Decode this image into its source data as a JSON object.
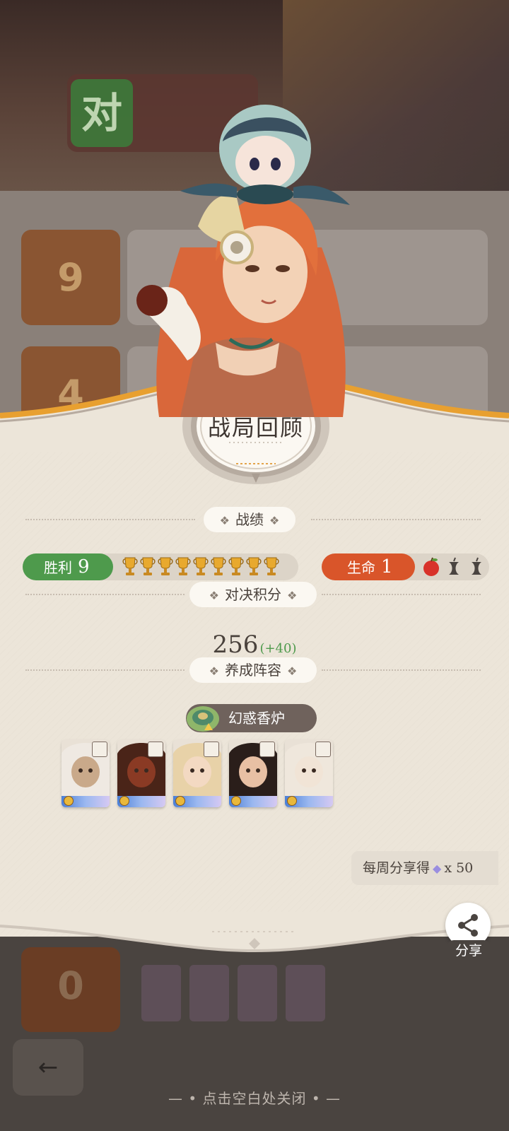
{
  "background": {
    "banner_char": "对",
    "card_values": [
      "9",
      "4"
    ],
    "bottom_card_value": "0"
  },
  "panel": {
    "title": "战局回顾",
    "record_header": "战绩",
    "wins_label": "胜利",
    "wins_value": "9",
    "trophy_count": 9,
    "life_label": "生命",
    "life_value": "1",
    "lives_remaining": 1,
    "lives_total": 3,
    "score_header": "对决积分",
    "score_value": "256",
    "score_delta": "(+40)",
    "lineup_header": "养成阵容",
    "relic_name": "幻惑香炉",
    "heroes": [
      {
        "skin": "#c9a98a",
        "hair": "#efe9e2"
      },
      {
        "skin": "#8a3a24",
        "hair": "#4a2418"
      },
      {
        "skin": "#f3d9c2",
        "hair": "#e8d2a8"
      },
      {
        "skin": "#e8c0a4",
        "hair": "#2a1e1a"
      },
      {
        "skin": "#f1e4d6",
        "hair": "#efe7dc"
      }
    ]
  },
  "weekly_share": {
    "text": "每周分享得",
    "reward": "x 50"
  },
  "share": {
    "label": "分享"
  },
  "footer": {
    "close_hint": "— • 点击空白处关闭 • —"
  },
  "colors": {
    "win_green": "#4e9a4c",
    "life_orange": "#d9552a",
    "panel_bg": "#ece5d9",
    "trophy_gold": "#e8a92e"
  }
}
